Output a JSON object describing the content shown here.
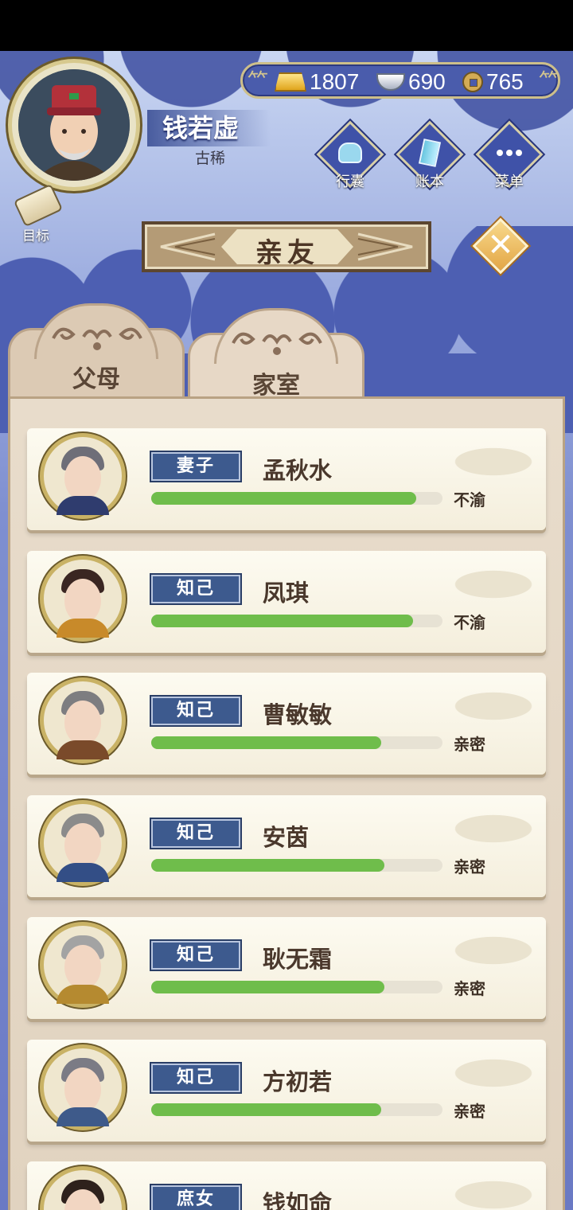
{
  "player": {
    "name": "钱若虚",
    "age_title": "古稀"
  },
  "goal": {
    "label": "目标"
  },
  "currency": {
    "gold": "1807",
    "silver": "690",
    "coins": "765"
  },
  "menu": {
    "bag_label": "行囊",
    "ledger_label": "账本",
    "menu_label": "菜单"
  },
  "title": "亲友",
  "tabs": {
    "parents": "父母",
    "family": "家室",
    "active": "family"
  },
  "relations": [
    {
      "role": "妻子",
      "name": "孟秋水",
      "status": "不渝",
      "affinity": 0.91
    },
    {
      "role": "知己",
      "name": "凤琪",
      "status": "不渝",
      "affinity": 0.9
    },
    {
      "role": "知己",
      "name": "曹敏敏",
      "status": "亲密",
      "affinity": 0.79
    },
    {
      "role": "知己",
      "name": "安茵",
      "status": "亲密",
      "affinity": 0.8
    },
    {
      "role": "知己",
      "name": "耿无霜",
      "status": "亲密",
      "affinity": 0.8
    },
    {
      "role": "知己",
      "name": "方初若",
      "status": "亲密",
      "affinity": 0.79
    },
    {
      "role": "庶女",
      "name": "钱如命",
      "status": "",
      "affinity": 0.0
    }
  ],
  "colors": {
    "accent_blue": "#3d5a8e",
    "bar_green": "#6fbd4b",
    "card_bg": "#fdfbf1"
  }
}
